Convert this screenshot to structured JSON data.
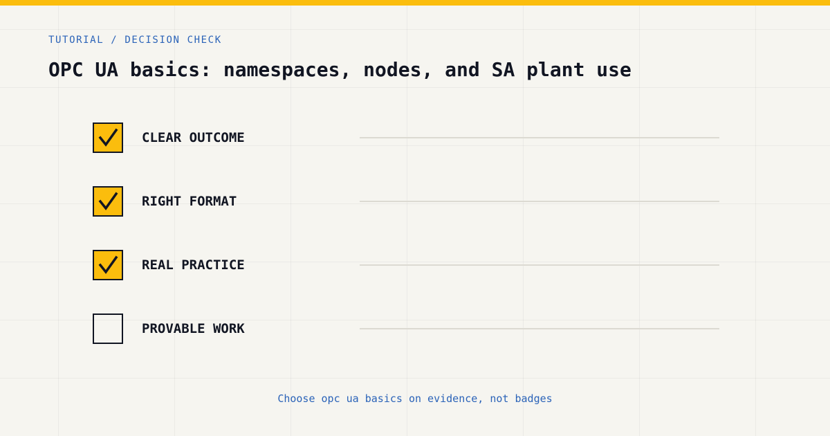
{
  "header": {
    "breadcrumb": "TUTORIAL / DECISION CHECK",
    "title": "OPC UA basics: namespaces, nodes, and SA plant use"
  },
  "checklist": {
    "items": [
      {
        "label": "CLEAR OUTCOME",
        "checked": true
      },
      {
        "label": "RIGHT FORMAT",
        "checked": true
      },
      {
        "label": "REAL PRACTICE",
        "checked": true
      },
      {
        "label": "PROVABLE WORK",
        "checked": false
      }
    ]
  },
  "footer": {
    "note": "Choose opc ua basics on evidence, not badges"
  },
  "colors": {
    "accent": "#fbbd0d",
    "link": "#2b63b8",
    "text": "#111522",
    "background": "#f6f5f0"
  },
  "icons": {
    "check": "checkmark-icon"
  }
}
